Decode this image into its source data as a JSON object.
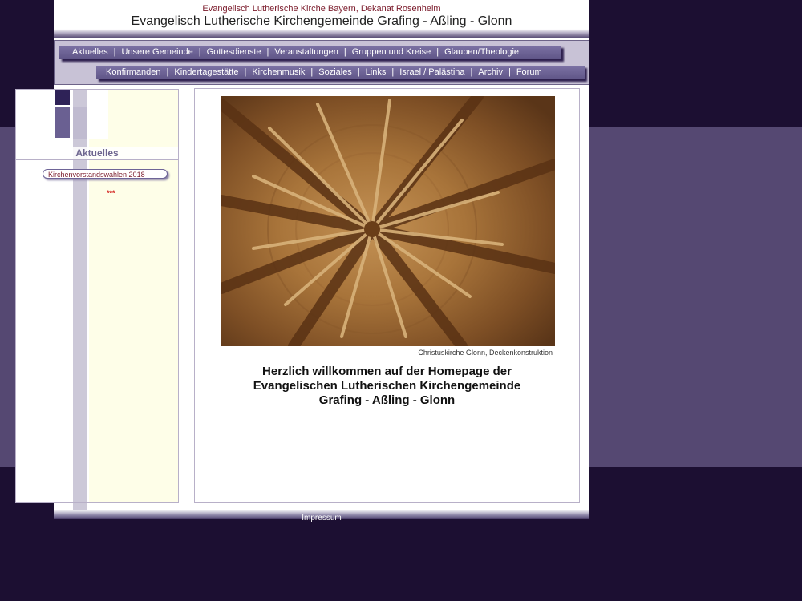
{
  "header": {
    "tagline": "Evangelisch Lutherische Kirche Bayern, Dekanat Rosenheim",
    "title": "Evangelisch Lutherische Kirchengemeinde Grafing - Aßling - Glonn"
  },
  "nav_primary": [
    "Aktuelles",
    "Unsere Gemeinde",
    "Gottesdienste",
    "Veranstaltungen",
    "Gruppen und Kreise",
    "Glauben/Theologie"
  ],
  "nav_secondary": [
    "Konfirmanden",
    "Kindertagestätte",
    "Kirchenmusik",
    "Soziales",
    "Links",
    "Israel / Palästina",
    "Archiv",
    "Forum"
  ],
  "nav_separator": "|",
  "sidebar": {
    "section_title": "Aktuelles",
    "news_link": "Kirchenvorstandswahlen 2018",
    "stars": "***"
  },
  "content": {
    "photo_caption": "Christuskirche Glonn, Deckenkonstruktion",
    "welcome_line1": "Herzlich willkommen auf der Homepage der",
    "welcome_line2": "Evangelischen Lutherischen Kirchengemeinde",
    "welcome_line3": "Grafing - Aßling - Glonn"
  },
  "footer": {
    "impressum": "Impressum"
  },
  "colors": {
    "accent": "#6e6497",
    "dark": "#1c0f32",
    "band": "#554872",
    "cream": "#fefee8"
  }
}
